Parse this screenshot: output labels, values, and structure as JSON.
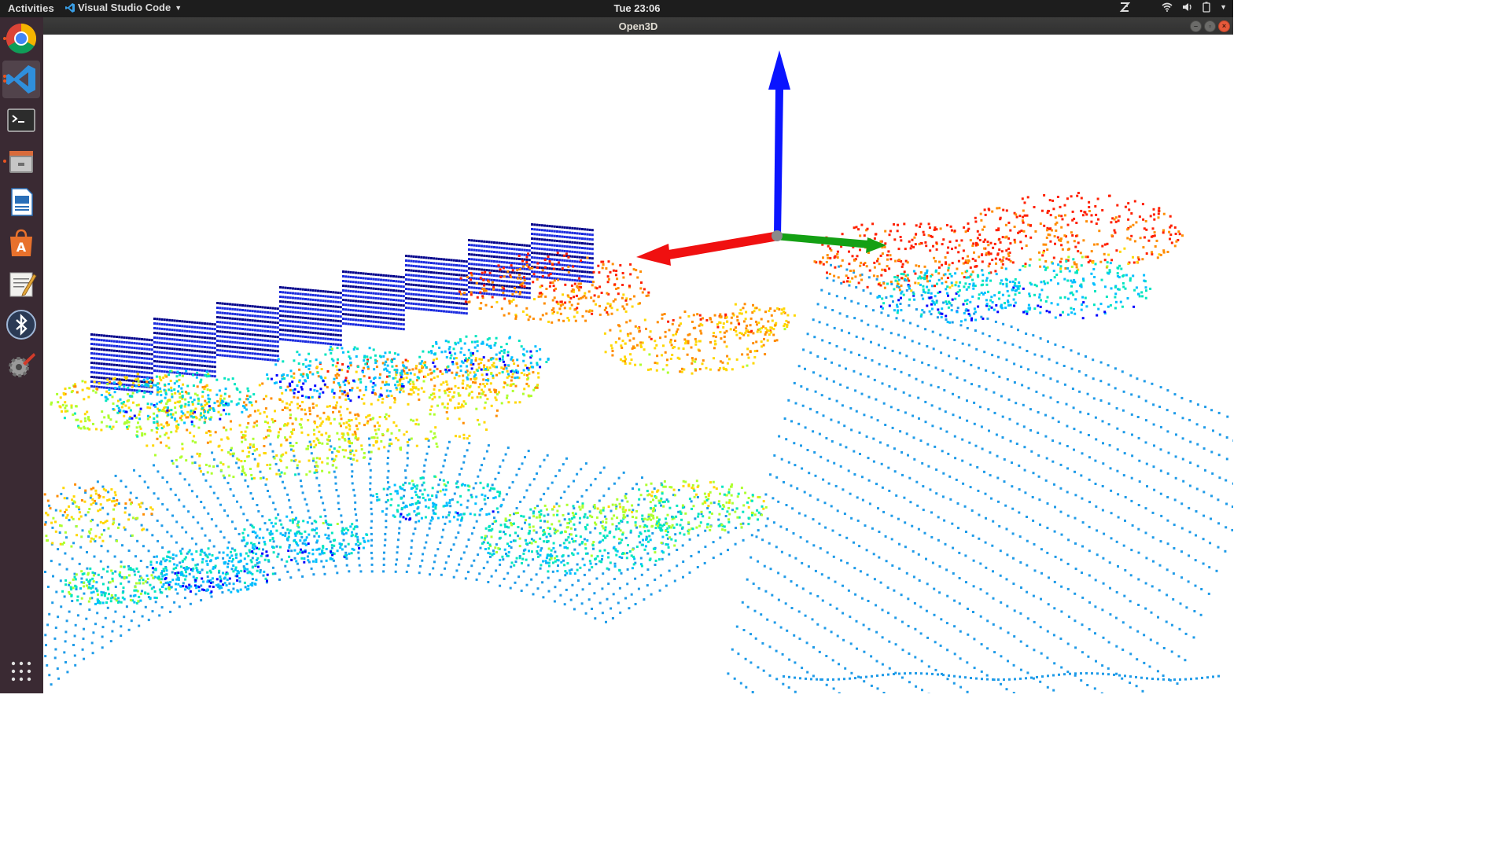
{
  "topbar": {
    "activities": "Activities",
    "app_menu": "Visual Studio Code",
    "clock": "Tue 23:06"
  },
  "window": {
    "title": "Open3D"
  },
  "dock": {
    "items": [
      {
        "name": "chrome",
        "icon": "chrome-icon",
        "running": true
      },
      {
        "name": "vscode",
        "icon": "vscode-icon",
        "running": true,
        "active": true
      },
      {
        "name": "terminal",
        "icon": "terminal-icon",
        "running": false
      },
      {
        "name": "files",
        "icon": "files-icon",
        "running": true
      },
      {
        "name": "writer",
        "icon": "writer-icon",
        "running": false
      },
      {
        "name": "software",
        "icon": "software-icon",
        "running": false
      },
      {
        "name": "text-editor",
        "icon": "text-editor-icon",
        "running": false
      },
      {
        "name": "bluetooth",
        "icon": "bluetooth-icon",
        "running": false
      },
      {
        "name": "settings",
        "icon": "settings-icon",
        "running": false
      }
    ],
    "apps_grid": "show-apps-icon"
  },
  "viewport": {
    "axes": {
      "x_color": "#ff0000",
      "y_color": "#00b000",
      "z_color": "#0000ff"
    },
    "colormap": [
      "#00008b",
      "#0000ff",
      "#00bfff",
      "#00e5c0",
      "#adff2f",
      "#ffd700",
      "#ff8c00",
      "#ff2000"
    ]
  }
}
